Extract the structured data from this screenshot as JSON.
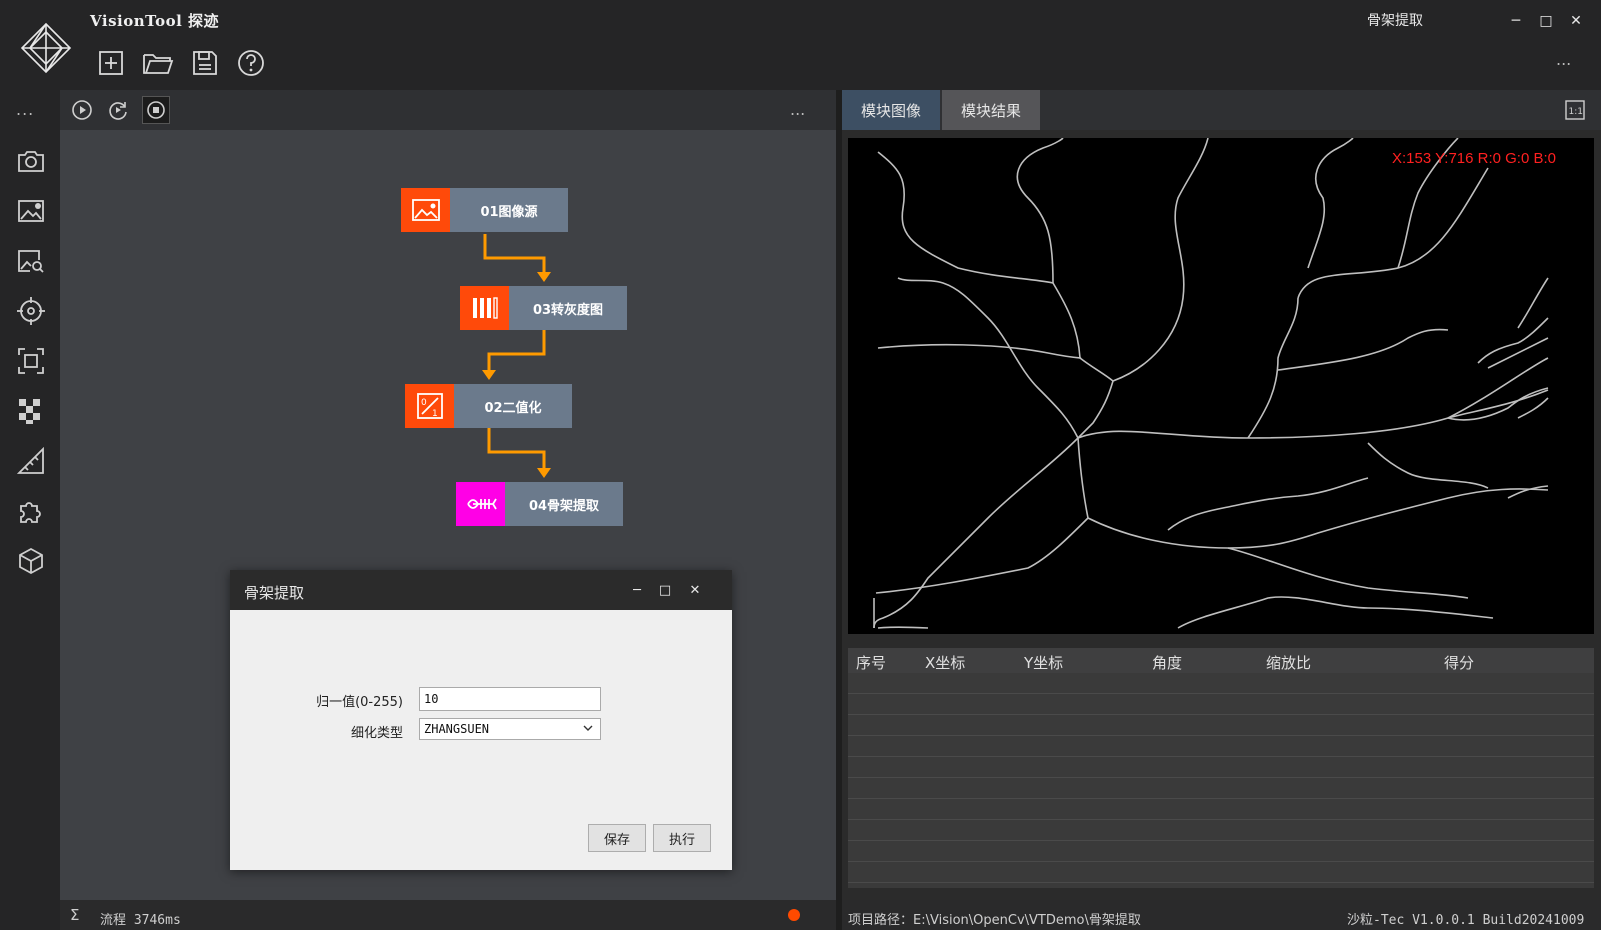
{
  "app": {
    "title": "VisionTool 探迹",
    "window_caption": "骨架提取"
  },
  "window_controls": {
    "minimize": "─",
    "maximize": "□",
    "close": "✕"
  },
  "toolbar": {
    "more": "...",
    "buttons": [
      "new-file-icon",
      "open-folder-icon",
      "save-icon",
      "help-icon"
    ]
  },
  "sidebar": {
    "more": "...",
    "items": [
      "camera-icon",
      "image-settings-icon",
      "image-search-icon",
      "target-icon",
      "roi-icon",
      "checkerboard-icon",
      "ruler-icon",
      "puzzle-icon",
      "cube-icon"
    ]
  },
  "flow": {
    "more": "...",
    "nodes": [
      {
        "label": "01图像源",
        "icon": "image-icon",
        "color": "#ff4a0a"
      },
      {
        "label": "03转灰度图",
        "icon": "grayscale-icon",
        "color": "#ff4a0a"
      },
      {
        "label": "02二值化",
        "icon": "binarize-icon",
        "color": "#ff4a0a"
      },
      {
        "label": "04骨架提取",
        "icon": "fishbone-icon",
        "color": "#ff00e6"
      }
    ],
    "status": {
      "sigma": "Σ",
      "text": "流程 3746ms"
    }
  },
  "dialog": {
    "title": "骨架提取",
    "controls": {
      "minimize": "─",
      "maximize": "□",
      "close": "✕"
    },
    "fields": {
      "normalize_label": "归一值(0-255)",
      "normalize_value": "10",
      "thin_type_label": "细化类型",
      "thin_type_value": "ZHANGSUEN"
    },
    "buttons": {
      "save": "保存",
      "execute": "执行"
    }
  },
  "right_panel": {
    "tabs": [
      "模块图像",
      "模块结果"
    ],
    "fit_label": "1:1",
    "pixel_readout": "X:153 Y:716  R:0 G:0 B:0",
    "table": {
      "columns": [
        "序号",
        "X坐标",
        "Y坐标",
        "角度",
        "缩放比",
        "得分"
      ],
      "rows": []
    },
    "status": {
      "path": "项目路径：E:\\Vision\\OpenCv\\VTDemo\\骨架提取",
      "version": "沙粒-Tec V1.0.0.1 Build20241009"
    }
  },
  "colors": {
    "accent_orange": "#ff4a0a",
    "accent_magenta": "#ff00e6",
    "node_label_bg": "#6b7a8c",
    "connector": "#ff9a00",
    "readout": "#ff2020"
  }
}
